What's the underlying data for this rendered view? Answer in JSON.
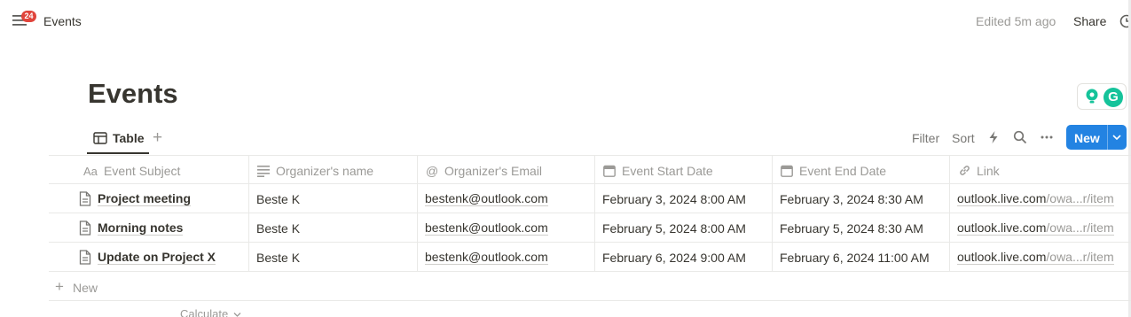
{
  "topbar": {
    "notification_count": "24",
    "breadcrumb": "Events",
    "edited": "Edited 5m ago",
    "share_label": "Share",
    "menu_icon": "hamburger-icon",
    "updates_icon": "clock-icon"
  },
  "page": {
    "title": "Events",
    "extension_icons": [
      "lightbulb-icon",
      "grammarly-icon"
    ]
  },
  "view_tabs": [
    {
      "label": "Table",
      "icon": "table-icon",
      "active": true
    }
  ],
  "add_view_label": "+",
  "toolbar": {
    "filter_label": "Filter",
    "sort_label": "Sort",
    "automation_icon": "lightning-icon",
    "search_icon": "search-icon",
    "more_icon": "more-icon",
    "new_label": "New"
  },
  "table": {
    "columns": [
      {
        "label": "Event Subject",
        "icon": "Aa"
      },
      {
        "label": "Organizer's name",
        "icon": "text-lines-icon"
      },
      {
        "label": "Organizer's Email",
        "icon": "@"
      },
      {
        "label": "Event Start Date",
        "icon": "calendar-icon"
      },
      {
        "label": "Event End Date",
        "icon": "calendar-icon"
      },
      {
        "label": "Link",
        "icon": "link-icon"
      }
    ],
    "rows": [
      {
        "subject": "Project meeting",
        "organizer": "Beste K",
        "email": "bestenk@outlook.com",
        "start": "February 3, 2024 8:00 AM",
        "end": "February 3, 2024 8:30 AM",
        "link_main": "outlook.live.com",
        "link_rest": "/owa...r/item"
      },
      {
        "subject": "Morning notes",
        "organizer": "Beste K",
        "email": "bestenk@outlook.com",
        "start": "February 5, 2024 8:00 AM",
        "end": "February 5, 2024 8:30 AM",
        "link_main": "outlook.live.com",
        "link_rest": "/owa...r/item"
      },
      {
        "subject": "Update on Project X",
        "organizer": "Beste K",
        "email": "bestenk@outlook.com",
        "start": "February 6, 2024 9:00 AM",
        "end": "February 6, 2024 11:00 AM",
        "link_main": "outlook.live.com",
        "link_rest": "/owa...r/item"
      }
    ],
    "add_row_label": "New",
    "calculate_label": "Calculate"
  },
  "colors": {
    "accent": "#2383e2",
    "badge": "#e0443b",
    "text": "#37352f",
    "muted": "#9b9a97",
    "grammarly": "#15c39a"
  }
}
